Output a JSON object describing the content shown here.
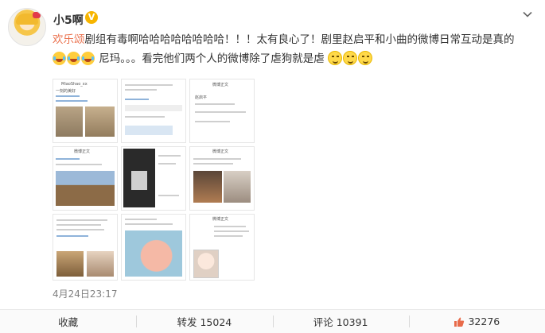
{
  "user": {
    "name": "小5啊",
    "badge": "V"
  },
  "post": {
    "mention": "欢乐颂",
    "text_line1": "剧组有毒啊哈哈哈哈哈哈哈哈！！！太有良心了！剧里赵启平和小曲的微博日常互动是真的",
    "text_mid": "尼玛。。。看完他们两个人的微博除了虐狗就是虐",
    "emojis_before": [
      "laugh-emoji",
      "laugh-emoji",
      "laugh-emoji"
    ],
    "emojis_after": [
      "sly-smile-emoji",
      "sly-smile-emoji",
      "sly-smile-emoji"
    ]
  },
  "collage": {
    "shot1_user": "MiaoShao_xx",
    "shot1_text": "一刻的美好",
    "shot2_title": "微博正文",
    "shot3_title": "微博正文",
    "shot3_user": "赵启平",
    "shot4_title": "微博正文",
    "shot5_title": "微博正文",
    "shot6_title": "微博正文",
    "shot7_title": "微博正文"
  },
  "timestamp": "4月24日23:17",
  "actions": {
    "favorite": "收藏",
    "repost": "转发 15024",
    "comment": "评论 10391",
    "like_count": "32276"
  },
  "colors": {
    "mention": "#eb7350",
    "badge": "#f7b500"
  },
  "icons": {
    "chevron": "chevron-down-icon",
    "like": "thumbs-up-icon"
  }
}
